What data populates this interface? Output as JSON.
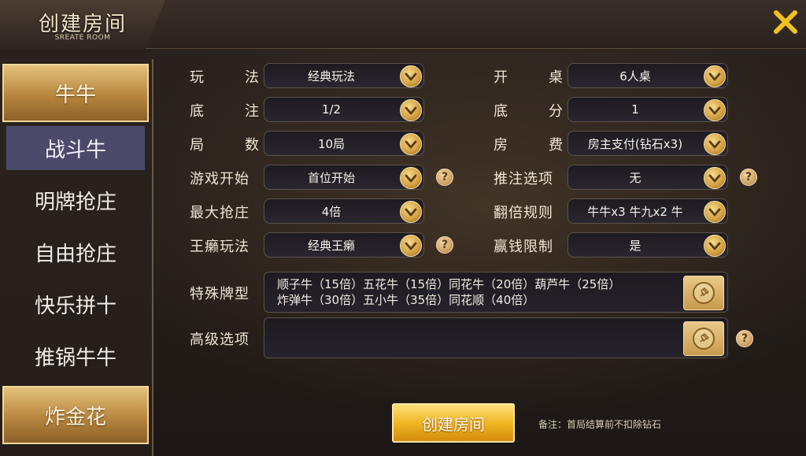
{
  "header": {
    "title": "创建房间",
    "subtitle": "SREATE ROOM"
  },
  "sidebar": {
    "items": [
      {
        "label": "牛牛",
        "kind": "category"
      },
      {
        "label": "战斗牛",
        "kind": "selected"
      },
      {
        "label": "明牌抢庄",
        "kind": "normal"
      },
      {
        "label": "自由抢庄",
        "kind": "normal"
      },
      {
        "label": "快乐拼十",
        "kind": "normal"
      },
      {
        "label": "推锅牛牛",
        "kind": "normal"
      },
      {
        "label": "炸金花",
        "kind": "category"
      }
    ]
  },
  "form": {
    "left": [
      {
        "label": "玩法",
        "value": "经典玩法",
        "help": false
      },
      {
        "label": "底注",
        "value": "1/2",
        "help": false
      },
      {
        "label": "局数",
        "value": "10局",
        "help": false
      },
      {
        "label": "游戏开始",
        "value": "首位开始",
        "help": true
      },
      {
        "label": "最大抢庄",
        "value": "4倍",
        "help": false
      },
      {
        "label": "王癞玩法",
        "value": "经典王癞",
        "help": true
      }
    ],
    "right": [
      {
        "label": "开桌",
        "value": "6人桌",
        "help": false
      },
      {
        "label": "底分",
        "value": "1",
        "help": false
      },
      {
        "label": "房费",
        "value": "房主支付(钻石x3)",
        "help": false
      },
      {
        "label": "推注选项",
        "value": "无",
        "help": true
      },
      {
        "label": "翻倍规则",
        "value": "牛牛x3 牛九x2 牛",
        "help": false
      },
      {
        "label": "赢钱限制",
        "value": "是",
        "help": false
      }
    ],
    "special_cards": {
      "label": "特殊牌型",
      "line1": "顺子牛（15倍）五花牛（15倍）同花牛（20倍）葫芦牛（25倍）",
      "line2": "炸弹牛（30倍）五小牛（35倍）同花顺（40倍）"
    },
    "advanced": {
      "label": "高级选项",
      "value": ""
    }
  },
  "actions": {
    "create_label": "创建房间",
    "note": "备注：首局结算前不扣除钻石"
  },
  "icons": {
    "close": "close-icon",
    "chevron": "chevron-down-icon",
    "help": "question-icon",
    "pin": "pin-icon"
  },
  "colors": {
    "accent_gold": "#e9b84a",
    "selected_tab": "#4b4a6a",
    "close_icon": "#f2c21a"
  }
}
